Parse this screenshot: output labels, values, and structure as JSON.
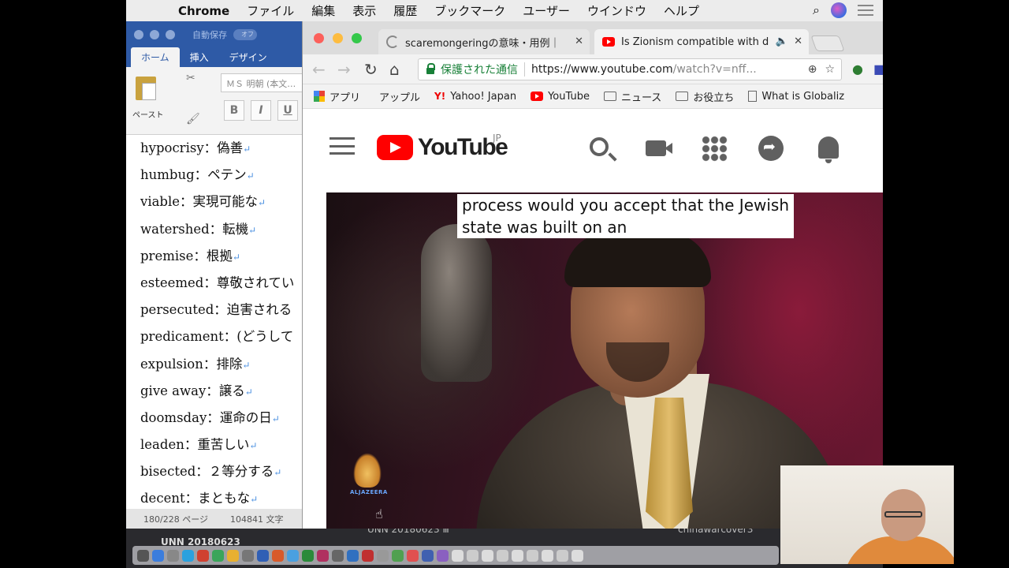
{
  "menubar": {
    "app": "Chrome",
    "items": [
      "ファイル",
      "編集",
      "表示",
      "履歴",
      "ブックマーク",
      "ユーザー",
      "ウインドウ",
      "ヘルプ"
    ]
  },
  "word": {
    "autosave": "自動保存",
    "autosave_state": "オフ",
    "tabs": [
      "ホーム",
      "挿入",
      "デザイン"
    ],
    "paste_label": "ペースト",
    "font_name": "ＭＳ 明朝 (本文…",
    "format_buttons": [
      "B",
      "I",
      "U"
    ],
    "vocab": [
      "hypocrisy：偽善",
      "humbug：ペテン",
      "viable：実現可能な",
      "watershed：転機",
      "premise：根拠",
      "esteemed：尊敬されてい",
      "persecuted：迫害される",
      "predicament：(どうして",
      "expulsion：排除",
      "give away：譲る",
      "doomsday：運命の日",
      "leaden：重苦しい",
      "bisected：２等分する",
      "decent：まともな"
    ],
    "status_pages": "180/228 ページ",
    "status_words": "104841 文字"
  },
  "chrome": {
    "tabs": [
      {
        "title": "scaremongeringの意味・用例｜"
      },
      {
        "title": "Is Zionism compatible with d"
      }
    ],
    "omnibox": {
      "secure_label": "保護された通信",
      "url_host": "https://www.youtube.com",
      "url_path": "/watch?v=nff..."
    },
    "bookmarks": [
      "アプリ",
      "アップル",
      "Yahoo! Japan",
      "YouTube",
      "ニュース",
      "お役立ち",
      "What is Globaliz"
    ]
  },
  "youtube": {
    "wordmark": "YouTube",
    "country": "JP",
    "caption_line1": "process would you accept that the Jewish",
    "caption_line2": "state was built on an",
    "channel_logo_text": "ALJAZEERA"
  },
  "desktop": {
    "label1": "UNN 20180623",
    "label2": "UNN 20180623 Ⅲ",
    "label3": "chinawarcover3"
  },
  "colors": {
    "youtube_red": "#ff0000",
    "word_blue": "#2e5aa6",
    "secure_green": "#188038"
  }
}
